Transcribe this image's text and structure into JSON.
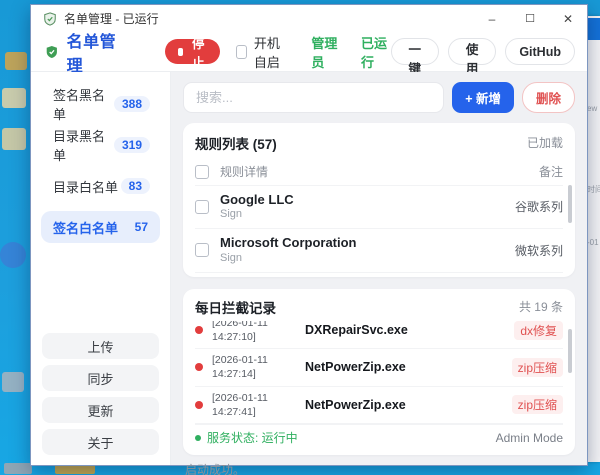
{
  "window": {
    "title": "名单管理 - 已运行",
    "minimize": "–",
    "maximize": "☐",
    "close": "✕"
  },
  "header": {
    "app_title": "名单管理",
    "stop_button": "停止",
    "autostart_label": "开机自启",
    "admin_label": "管理员",
    "running_label": "已运行",
    "disguise_button": "一键伪装",
    "guide_button": "使用指南",
    "github_button": "GitHub"
  },
  "sidebar": {
    "items": [
      {
        "label": "签名黑名单",
        "count": "388"
      },
      {
        "label": "目录黑名单",
        "count": "319"
      },
      {
        "label": "目录白名单",
        "count": "83"
      },
      {
        "label": "签名白名单",
        "count": "57"
      }
    ],
    "upload_button": "上传",
    "sync_button": "同步",
    "update_button": "更新",
    "about_button": "关于"
  },
  "toolbar": {
    "search_placeholder": "搜索...",
    "add_button": "+ 新增",
    "delete_button": "删除"
  },
  "rules_panel": {
    "title": "规则列表 (57)",
    "loaded_status": "已加载",
    "col_rule": "规则详情",
    "col_note": "备注",
    "rows": [
      {
        "name": "Google LLC",
        "type": "Sign",
        "note": "谷歌系列"
      },
      {
        "name": "Microsoft Corporation",
        "type": "Sign",
        "note": "微软系列"
      }
    ]
  },
  "log_panel": {
    "title": "每日拦截记录",
    "total": "共 19 条",
    "rows": [
      {
        "date": "[2026-01-11",
        "time": "14:27:10]",
        "file": "DXRepairSvc.exe",
        "tag": "dx修复"
      },
      {
        "date": "[2026-01-11",
        "time": "14:27:14]",
        "file": "NetPowerZip.exe",
        "tag": "zip压缩"
      },
      {
        "date": "[2026-01-11",
        "time": "14:27:41]",
        "file": "NetPowerZip.exe",
        "tag": "zip压缩"
      }
    ],
    "service_status": "服务状态: 运行中",
    "mode_label": "Admin Mode"
  },
  "status_bar": {
    "message": "启动成功。"
  },
  "colors": {
    "accent_blue": "#2563eb",
    "danger_red": "#e23d3d",
    "success_green": "#2faf5f"
  }
}
